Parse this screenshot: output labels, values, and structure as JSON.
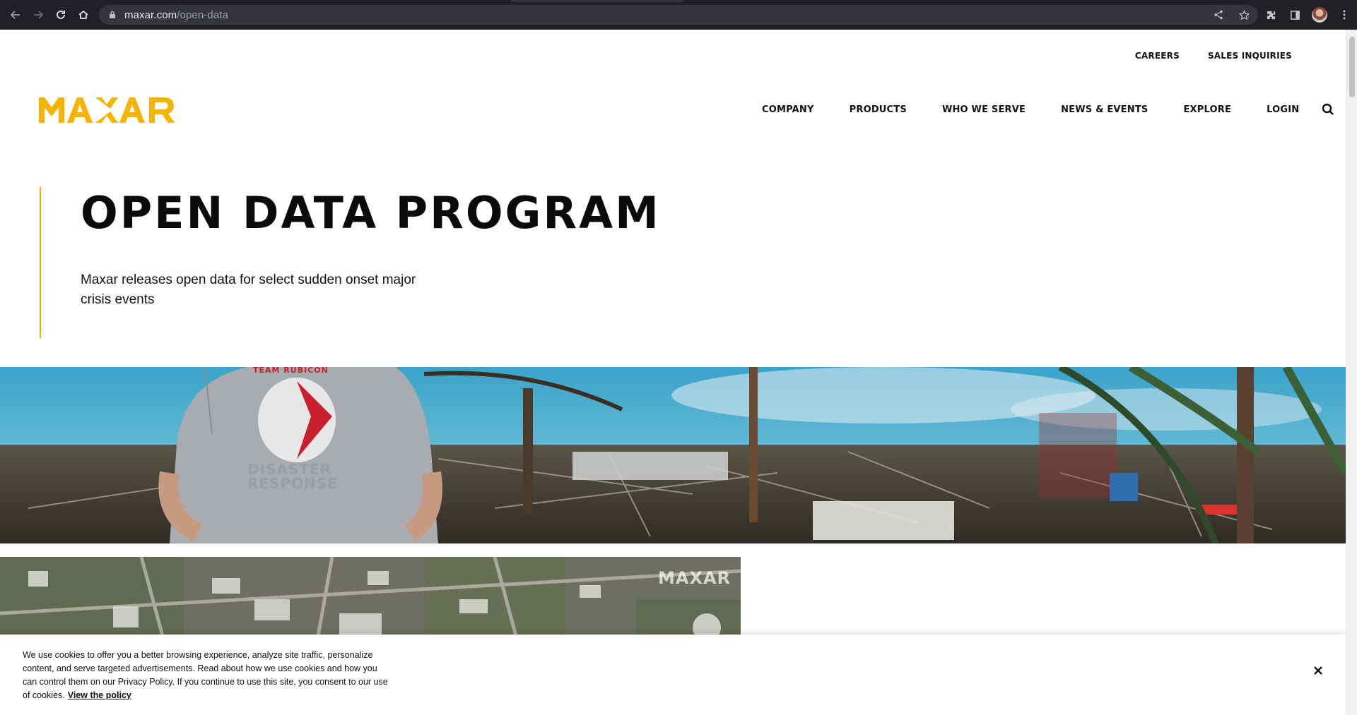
{
  "browser": {
    "url_domain": "maxar.com",
    "url_path": "/open-data"
  },
  "utility_nav": {
    "careers": "CAREERS",
    "sales": "SALES INQUIRIES"
  },
  "logo_text": "MAXAR",
  "main_nav": {
    "items": [
      "COMPANY",
      "PRODUCTS",
      "WHO WE SERVE",
      "NEWS & EVENTS",
      "EXPLORE",
      "LOGIN"
    ]
  },
  "hero": {
    "title": "OPEN DATA PROGRAM",
    "subtitle": "Maxar releases open data for select sudden onset major crisis events"
  },
  "banner": {
    "shirt_top_text": "TEAM RUBICON",
    "shirt_text": "DISASTER RESPONSE"
  },
  "satellite": {
    "watermark": "MAXAR"
  },
  "cookie": {
    "message": "We use cookies to offer you a better browsing experience, analyze site traffic, personalize content, and serve targeted advertisements. Read about how we use cookies and how you can control them on our Privacy Policy. If you continue to use this site, you consent to our use of cookies.",
    "link": "View the policy",
    "close": "✕"
  },
  "colors": {
    "brand_yellow": "#f5b400",
    "accent_orange": "#f5a800",
    "chrome_bg": "#202124"
  }
}
